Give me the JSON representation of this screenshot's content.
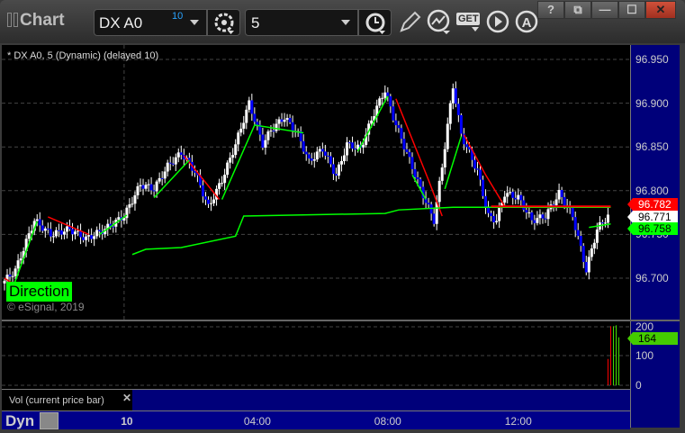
{
  "window": {
    "title": "Chart",
    "help": "?",
    "minimize": "—",
    "maximize": "☐",
    "close": "✕"
  },
  "toolbar": {
    "symbol": "DX A0",
    "symbol_badge": "10",
    "interval": "5",
    "icons": [
      "settings-gear-icon",
      "clock-icon",
      "pencil-icon",
      "study-icon",
      "get-icon",
      "play-icon",
      "alert-icon"
    ],
    "get_label": "GET"
  },
  "chart": {
    "legend": "* DX A0, 5 (Dynamic) (delayed 10)",
    "direction_label": "Direction",
    "copyright": "© eSignal, 2019",
    "price_labels": [
      "96.950",
      "96.900",
      "96.850",
      "96.800",
      "96.750",
      "96.700"
    ],
    "tags": {
      "red": "96.782",
      "last": "96.771",
      "green": "96.758"
    },
    "colors": {
      "up": "#ffffff",
      "down": "#0000ff",
      "red": "#ff0000",
      "green": "#00ff00",
      "axis_bg": "#00007a"
    }
  },
  "volume": {
    "label": "Vol (current price bar)",
    "close": "✕",
    "ticks": [
      "200",
      "100",
      "0"
    ],
    "tag": "164"
  },
  "timeaxis": {
    "mode": "Dyn",
    "labels": [
      {
        "t": "10",
        "bar": 45,
        "bold": true
      },
      {
        "t": "04:00",
        "bar": 93
      },
      {
        "t": "08:00",
        "bar": 141
      },
      {
        "t": "12:00",
        "bar": 189
      }
    ]
  },
  "chart_data": {
    "type": "candlestick",
    "symbol": "DX A0",
    "interval": "5 min",
    "ylim": [
      96.67,
      96.965
    ],
    "close": [
      [
        0,
        96.694
      ],
      [
        5,
        96.709
      ],
      [
        12,
        96.766
      ],
      [
        18,
        96.75
      ],
      [
        25,
        96.756
      ],
      [
        31,
        96.745
      ],
      [
        38,
        96.756
      ],
      [
        45,
        96.771
      ],
      [
        51,
        96.807
      ],
      [
        56,
        96.802
      ],
      [
        61,
        96.828
      ],
      [
        66,
        96.843
      ],
      [
        71,
        96.822
      ],
      [
        76,
        96.781
      ],
      [
        81,
        96.812
      ],
      [
        86,
        96.853
      ],
      [
        91,
        96.9
      ],
      [
        96,
        96.853
      ],
      [
        99,
        96.869
      ],
      [
        104,
        96.884
      ],
      [
        109,
        96.864
      ],
      [
        113,
        96.833
      ],
      [
        118,
        96.848
      ],
      [
        123,
        96.817
      ],
      [
        127,
        96.853
      ],
      [
        132,
        96.848
      ],
      [
        137,
        96.889
      ],
      [
        141,
        96.915
      ],
      [
        144,
        96.884
      ],
      [
        149,
        96.843
      ],
      [
        154,
        96.802
      ],
      [
        159,
        96.766
      ],
      [
        162,
        96.828
      ],
      [
        166,
        96.92
      ],
      [
        169,
        96.864
      ],
      [
        172,
        96.843
      ],
      [
        175,
        96.822
      ],
      [
        179,
        96.771
      ],
      [
        182,
        96.766
      ],
      [
        185,
        96.797
      ],
      [
        190,
        96.792
      ],
      [
        195,
        96.766
      ],
      [
        200,
        96.771
      ],
      [
        205,
        96.797
      ],
      [
        210,
        96.771
      ],
      [
        215,
        96.709
      ],
      [
        219,
        96.756
      ],
      [
        223,
        96.771
      ]
    ],
    "red_line": [
      [
        [
          0,
          96.7
        ],
        [
          4,
          96.692
        ]
      ],
      [
        [
          16,
          96.77
        ],
        [
          31,
          96.75
        ]
      ],
      [
        [
          66,
          96.84
        ],
        [
          79,
          96.79
        ]
      ],
      [
        [
          144,
          96.905
        ],
        [
          156,
          96.812
        ],
        [
          161,
          96.771
        ]
      ],
      [
        [
          169,
          96.864
        ],
        [
          177,
          96.818
        ],
        [
          184,
          96.782
        ],
        [
          223,
          96.782
        ]
      ]
    ],
    "green_line": [
      [
        [
          2,
          96.68
        ],
        [
          12,
          96.765
        ]
      ],
      [
        [
          35,
          96.75
        ],
        [
          45,
          96.772
        ]
      ],
      [
        [
          55,
          96.792
        ],
        [
          68,
          96.835
        ]
      ],
      [
        [
          80,
          96.79
        ],
        [
          92,
          96.875
        ],
        [
          110,
          96.866
        ]
      ],
      [
        [
          130,
          96.845
        ],
        [
          141,
          96.908
        ]
      ],
      [
        [
          150,
          96.818
        ],
        [
          155,
          96.79
        ]
      ],
      [
        [
          162,
          96.802
        ],
        [
          168,
          96.862
        ]
      ],
      [
        [
          215,
          96.758
        ],
        [
          223,
          96.762
        ]
      ]
    ],
    "green_step": [
      [
        47,
        96.727
      ],
      [
        52,
        96.733
      ],
      [
        65,
        96.735
      ],
      [
        85,
        96.748
      ],
      [
        88,
        96.771
      ],
      [
        140,
        96.774
      ],
      [
        145,
        96.778
      ],
      [
        165,
        96.781
      ],
      [
        223,
        96.781
      ]
    ],
    "volume": [
      [
        222,
        90
      ],
      [
        223,
        202
      ],
      [
        224,
        202
      ],
      [
        225,
        205
      ],
      [
        226,
        164
      ]
    ],
    "volume_colors": [
      "red",
      "red",
      "green",
      "green",
      "green"
    ],
    "vol_ylim": [
      0,
      200
    ]
  }
}
